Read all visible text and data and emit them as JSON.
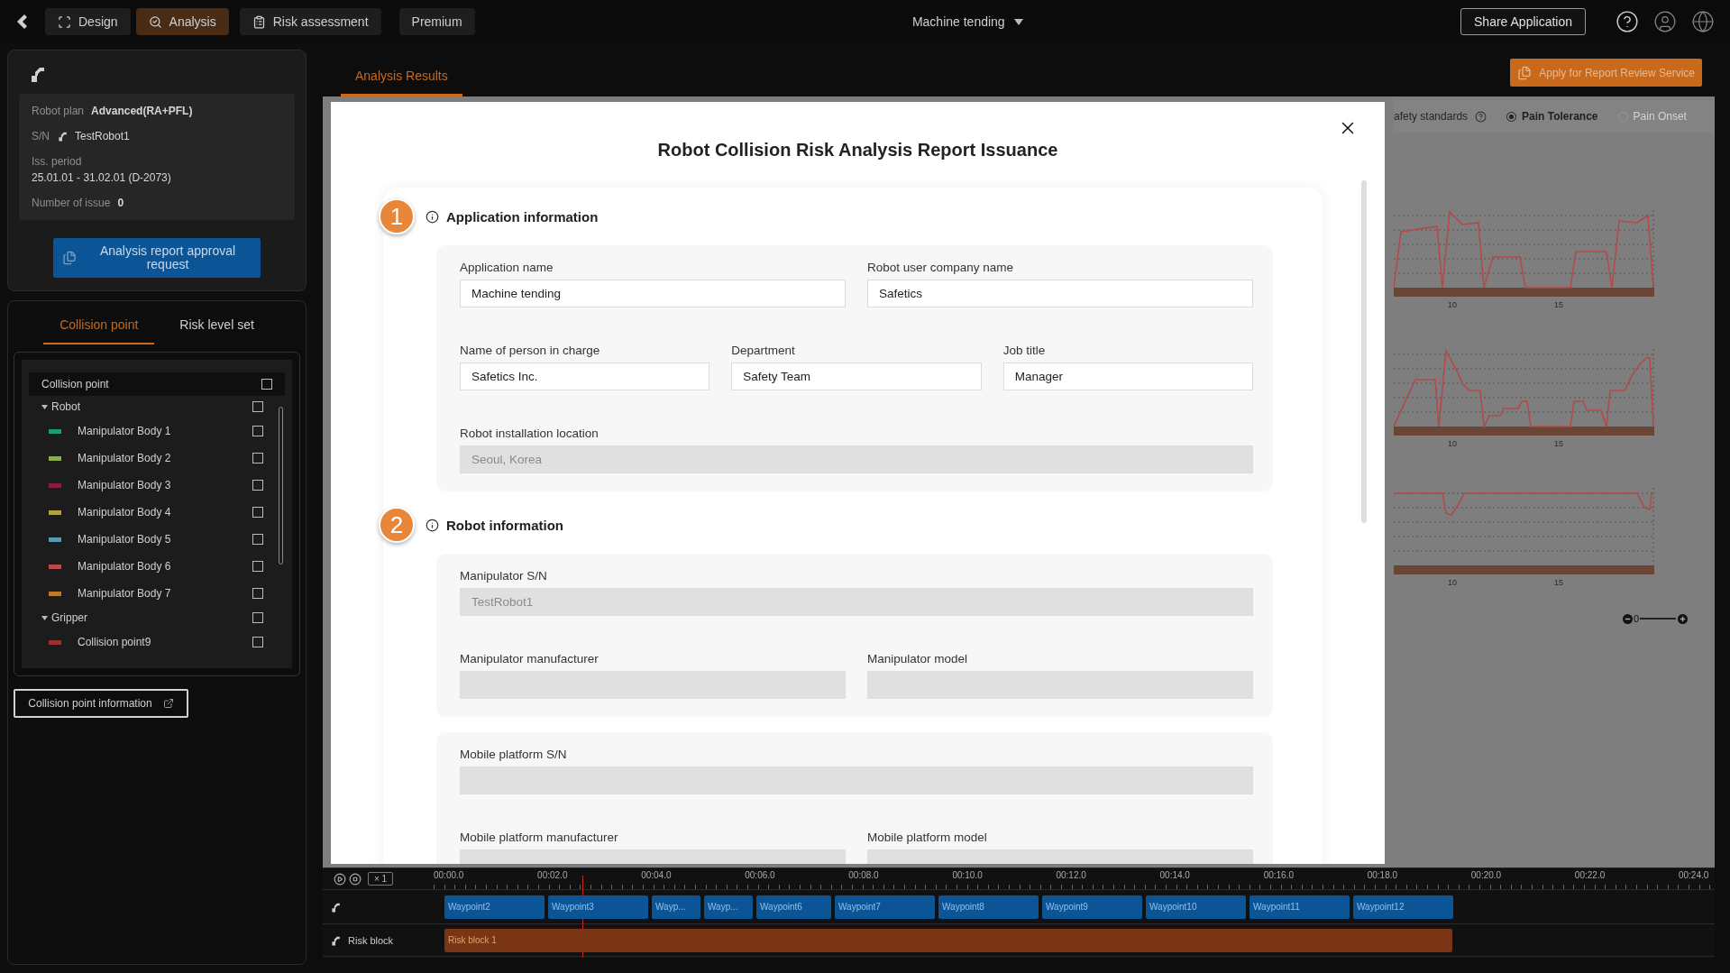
{
  "top_bar": {
    "tabs": [
      {
        "label": "Design",
        "kind": "design",
        "selected": false
      },
      {
        "label": "Analysis",
        "kind": "analysis",
        "selected": true
      },
      {
        "label": "Risk assessment",
        "kind": "risk",
        "selected": false
      },
      {
        "label": "Premium",
        "kind": "plain",
        "selected": false
      }
    ],
    "project": "Machine tending",
    "share_button": "Share Application"
  },
  "robot_card": {
    "info": [
      {
        "label": "Robot plan",
        "value": "Advanced(RA+PFL)",
        "kind": "inline"
      },
      {
        "label": "S/N",
        "value": "TestRobot1",
        "kind": "robot"
      },
      {
        "label": "Iss. period",
        "value": "25.01.01 - 31.02.01 (D-2073)",
        "kind": "stacked"
      },
      {
        "label": "Number of issue",
        "value": "0",
        "kind": "inline"
      }
    ],
    "button": "Analysis report approval request"
  },
  "side_tabs": [
    {
      "label": "Collision point",
      "selected": true
    },
    {
      "label": "Risk level set",
      "selected": false
    }
  ],
  "tree": {
    "header": {
      "label": "Collision point",
      "checked": false
    },
    "groups": [
      {
        "label": "Robot",
        "expanded": true,
        "checked": false,
        "children": [
          {
            "label": "Manipulator Body 1",
            "color": "#1a9e6a",
            "checked": false
          },
          {
            "label": "Manipulator Body 2",
            "color": "#8bae4a",
            "checked": false
          },
          {
            "label": "Manipulator Body 3",
            "color": "#8a1a48",
            "checked": false
          },
          {
            "label": "Manipulator Body 4",
            "color": "#b0a442",
            "checked": false
          },
          {
            "label": "Manipulator Body 5",
            "color": "#5a9ab0",
            "checked": false
          },
          {
            "label": "Manipulator Body 6",
            "color": "#c04848",
            "checked": false
          },
          {
            "label": "Manipulator Body 7",
            "color": "#c0782e",
            "checked": false
          }
        ]
      },
      {
        "label": "Gripper",
        "expanded": true,
        "checked": false,
        "children": [
          {
            "label": "Collision point9",
            "color": "#9a3030",
            "checked": false
          }
        ]
      }
    ]
  },
  "info_button": "Collision point information",
  "main": {
    "tabs": [
      {
        "label": "Analysis Results",
        "selected": true
      }
    ],
    "review_button": "Apply for Report Review Service",
    "standards": {
      "label": "afety standards",
      "options": [
        {
          "label": "Pain Tolerance",
          "selected": true
        },
        {
          "label": "Pain Onset",
          "selected": false
        }
      ]
    },
    "charts": [
      {
        "kind": "peaks",
        "tick_labels": [
          "10",
          "15"
        ]
      },
      {
        "kind": "steps",
        "tick_labels": [
          "10",
          "15"
        ]
      },
      {
        "kind": "dips",
        "tick_labels": [
          "10",
          "15"
        ]
      }
    ],
    "zoom": {
      "value": "0",
      "level": 0
    }
  },
  "dialog": {
    "title": "Robot Collision Risk Analysis Report Issuance",
    "sections": [
      {
        "number": "1",
        "title": "Application information",
        "groups": [
          [
            [
              {
                "label": "Application name",
                "value": "Machine tending",
                "disabled": false
              },
              {
                "label": "Robot user company name",
                "value": "Safetics",
                "disabled": false
              }
            ],
            [
              {
                "label": "Name of person in charge",
                "value": "Safetics Inc.",
                "disabled": false
              },
              {
                "label": "Department",
                "value": "Safety Team",
                "disabled": false
              },
              {
                "label": "Job title",
                "value": "Manager",
                "disabled": false
              }
            ],
            [
              {
                "label": "Robot installation location",
                "value": "Seoul, Korea",
                "disabled": true
              }
            ]
          ]
        ]
      },
      {
        "number": "2",
        "title": "Robot information",
        "groups": [
          [
            [
              {
                "label": "Manipulator S/N",
                "value": "TestRobot1",
                "disabled": true
              }
            ],
            [
              {
                "label": "Manipulator manufacturer",
                "disabled": true
              },
              {
                "label": "Manipulator model",
                "disabled": true
              }
            ]
          ],
          [
            [
              {
                "label": "Mobile platform S/N",
                "disabled": true
              }
            ],
            [
              {
                "label": "Mobile platform manufacturer",
                "disabled": true
              },
              {
                "label": "Mobile platform model",
                "disabled": true
              }
            ]
          ]
        ]
      }
    ]
  },
  "timeline": {
    "speed": "× 1",
    "ticks": [
      "00:00.0",
      "00:02.0",
      "00:04.0",
      "00:06.0",
      "00:08.0",
      "00:10.0",
      "00:12.0",
      "00:14.0",
      "00:16.0",
      "00:18.0",
      "00:20.0",
      "00:22.0",
      "00:24.0"
    ],
    "playhead": {
      "level": 0.107
    },
    "tracks": [
      {
        "kind": "waypoints",
        "blocks": [
          {
            "label": "Waypoint2",
            "kind": "wide"
          },
          {
            "label": "Waypoint3",
            "kind": "wide"
          },
          {
            "label": "Wayp...",
            "kind": "narrow"
          },
          {
            "label": "Wayp...",
            "kind": "narrow"
          },
          {
            "label": "Waypoint6",
            "kind": "mid"
          },
          {
            "label": "Waypoint7",
            "kind": "wide"
          },
          {
            "label": "Waypoint8",
            "kind": "wide"
          },
          {
            "label": "Waypoint9",
            "kind": "wide"
          },
          {
            "label": "Waypoint10",
            "kind": "wide"
          },
          {
            "label": "Waypoint11",
            "kind": "wide"
          },
          {
            "label": "Waypoint12",
            "kind": "wide"
          }
        ]
      },
      {
        "kind": "risk",
        "label": "Risk block",
        "blocks": [
          {
            "label": "Risk block 1",
            "kind": "full"
          }
        ]
      }
    ]
  }
}
